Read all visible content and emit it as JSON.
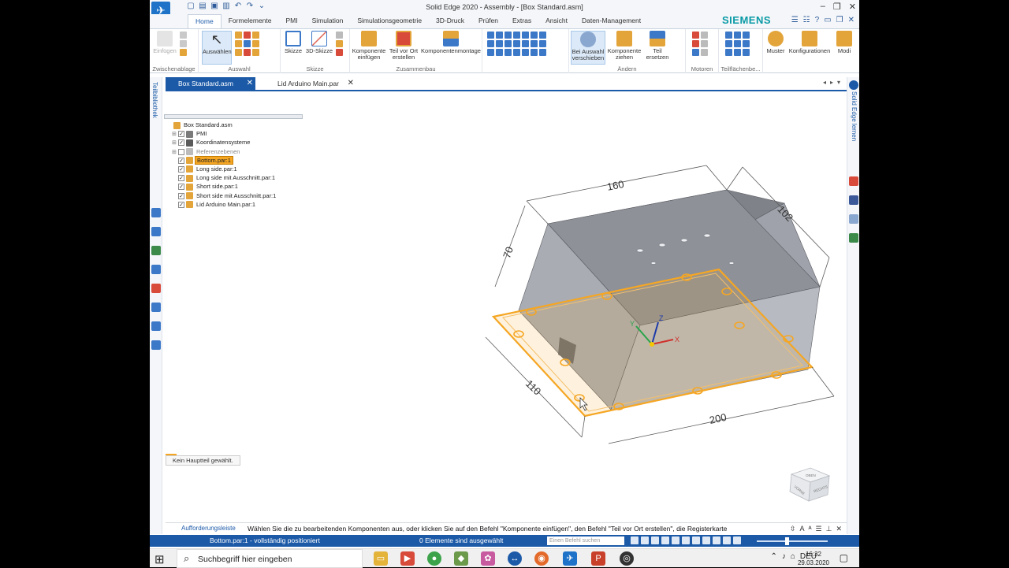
{
  "window": {
    "title": "Solid Edge 2020 - Assembly - [Box Standard.asm]",
    "brand": "SIEMENS"
  },
  "ribbon": {
    "tabs": [
      "Home",
      "Formelemente",
      "PMI",
      "Simulation",
      "Simulationsgeometrie",
      "3D-Druck",
      "Prüfen",
      "Extras",
      "Ansicht",
      "Daten-Management"
    ],
    "active_tab": "Home",
    "groups": {
      "clipboard": {
        "label": "Zwischenablage",
        "paste": "Einfügen"
      },
      "select": {
        "label": "Auswahl",
        "select_btn": "Auswählen"
      },
      "sketch": {
        "label": "Skizze",
        "sketch_btn": "Skizze",
        "sketch3d_btn": "3D-Skizze"
      },
      "assemble": {
        "label": "Zusammenbau",
        "insert_btn": "Komponente einfügen",
        "inplace_btn": "Teil vor Ort erstellen",
        "mount_btn": "Komponentenmontage"
      },
      "modify": {
        "label": "Ändern",
        "move_btn": "Bei Auswahl verschieben",
        "drag_btn": "Komponente ziehen",
        "replace_btn": "Teil ersetzen"
      },
      "motors": {
        "label": "Motoren"
      },
      "faces": {
        "label": "Teilflächenbe..."
      },
      "pattern": {
        "pattern_btn": "Muster"
      },
      "config": {
        "config_btn": "Konfigurationen"
      },
      "modes": {
        "modes_btn": "Modi"
      }
    }
  },
  "documents": {
    "tabs": [
      {
        "label": "Box Standard.asm",
        "active": true
      },
      {
        "label": "Lid Arduino Main.par",
        "active": false
      }
    ]
  },
  "left_rail": {
    "label": "Teilbibliothek"
  },
  "right_rail": {
    "label": "Solid Edge lernen"
  },
  "tree": {
    "nodes": [
      {
        "label": "Box Standard.asm",
        "level": 0,
        "exp": "",
        "check": false,
        "icon": "assembly-icon",
        "icon_color": "#e3a43a",
        "style": ""
      },
      {
        "label": "PMI",
        "level": 1,
        "exp": "+",
        "check": true,
        "icon": "pmi-icon",
        "icon_color": "#7a7a7a",
        "style": ""
      },
      {
        "label": "Koordinatensysteme",
        "level": 1,
        "exp": "+",
        "check": true,
        "icon": "coordinate-system-icon",
        "icon_color": "#5a5a5a",
        "style": ""
      },
      {
        "label": "Referenzebenen",
        "level": 1,
        "exp": "+",
        "check": false,
        "icon": "reference-plane-icon",
        "icon_color": "#bbbbbb",
        "style": "grey"
      },
      {
        "label": "Bottom.par:1",
        "level": 1,
        "exp": "",
        "check": true,
        "icon": "part-icon",
        "icon_color": "#e3a43a",
        "style": "sel"
      },
      {
        "label": "Long side.par:1",
        "level": 1,
        "exp": "",
        "check": true,
        "icon": "part-icon",
        "icon_color": "#e3a43a",
        "style": ""
      },
      {
        "label": "Long side mit Ausschnitt.par:1",
        "level": 1,
        "exp": "",
        "check": true,
        "icon": "part-icon",
        "icon_color": "#e3a43a",
        "style": ""
      },
      {
        "label": "Short side.par:1",
        "level": 1,
        "exp": "",
        "check": true,
        "icon": "part-icon",
        "icon_color": "#e3a43a",
        "style": ""
      },
      {
        "label": "Short side mit Ausschnitt.par:1",
        "level": 1,
        "exp": "",
        "check": true,
        "icon": "part-icon",
        "icon_color": "#e3a43a",
        "style": ""
      },
      {
        "label": "Lid Arduino Main.par:1",
        "level": 1,
        "exp": "",
        "check": true,
        "icon": "part-icon",
        "icon_color": "#e3a43a",
        "style": ""
      }
    ],
    "status_note": "Kein Hauptteil gewählt."
  },
  "model": {
    "dimensions": {
      "width": "160",
      "depth": "102",
      "height": "70",
      "base_depth": "110",
      "base_width": "200"
    },
    "axes": {
      "x": "X",
      "y": "Y",
      "z": "Z"
    },
    "colors": {
      "box_top": "#8f929b",
      "box_side": "#a3a6ae",
      "box_front": "#b4b7be",
      "highlight": "#f5a623",
      "dimension": "#5a5a5a"
    }
  },
  "viewcube": {
    "top": "OBEN",
    "front": "VORNE",
    "right": "RECHTS"
  },
  "prompt": {
    "label": "Aufforderungsleiste",
    "text": "Wählen Sie die zu bearbeitenden Komponenten aus, oder klicken Sie auf den Befehl \"Komponente einfügen\", den Befehl \"Teil vor Ort erstellen\", die Registerkarte"
  },
  "statusbar": {
    "left": "Bottom.par:1 - vollständig positioniert",
    "middle": "0 Elemente sind ausgewählt",
    "search_placeholder": "Einen Befehl suchen"
  },
  "taskbar": {
    "search_text": "Suchbegriff hier eingeben",
    "language": "DEU",
    "time": "16:32",
    "date": "29.03.2020"
  }
}
